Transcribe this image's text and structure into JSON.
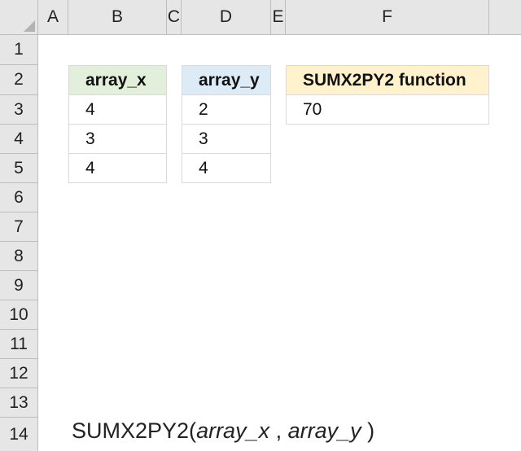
{
  "columns": [
    "A",
    "B",
    "C",
    "D",
    "E",
    "F"
  ],
  "rows": [
    "1",
    "2",
    "3",
    "4",
    "5",
    "6",
    "7",
    "8",
    "9",
    "10",
    "11",
    "12",
    "13",
    "14"
  ],
  "table_x": {
    "header": "array_x",
    "values": [
      "4",
      "3",
      "4"
    ]
  },
  "table_y": {
    "header": "array_y",
    "values": [
      "2",
      "3",
      "4"
    ]
  },
  "result": {
    "header": "SUMX2PY2 function",
    "value": "70"
  },
  "formula": {
    "name": "SUMX2PY2(",
    "arg1": "array_x",
    "sep": " , ",
    "arg2": "array_y",
    "close": " )"
  }
}
